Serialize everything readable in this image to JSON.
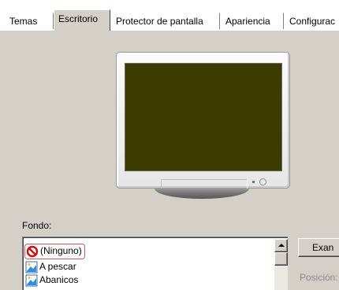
{
  "tabs": [
    {
      "label": "Temas"
    },
    {
      "label": "Escritorio"
    },
    {
      "label": "Protector de pantalla"
    },
    {
      "label": "Apariencia"
    },
    {
      "label": "Configurac"
    }
  ],
  "active_tab": "Escritorio",
  "background": {
    "label": "Fondo:",
    "items": [
      {
        "label": "(Ninguno)",
        "icon": "none-icon"
      },
      {
        "label": "A pescar",
        "icon": "wallpaper-icon"
      },
      {
        "label": "Abanicos",
        "icon": "wallpaper-icon"
      }
    ],
    "selected_index": 0
  },
  "browse_button": {
    "label": "Exan"
  },
  "position_label": "Posición:",
  "colors": {
    "panel": "#d4d0c8",
    "preview_screen": "#3c3c00",
    "selection_border": "#cc2222"
  }
}
